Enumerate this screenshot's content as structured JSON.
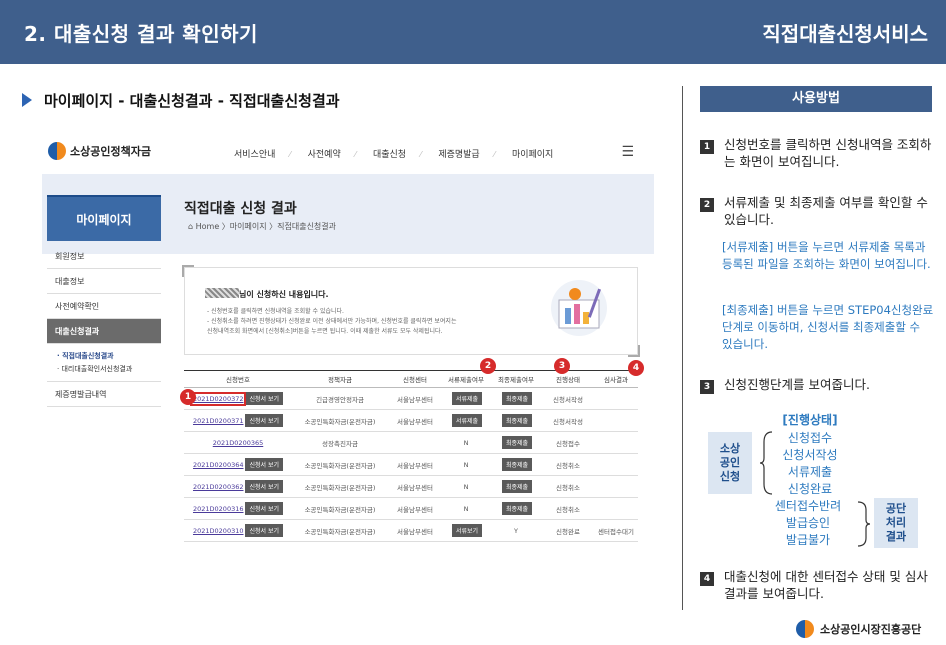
{
  "header": {
    "title": "2. 대출신청 결과 확인하기",
    "service": "직접대출신청서비스"
  },
  "section": {
    "title": "마이페이지 - 대출신청결과 - 직접대출신청결과"
  },
  "site": {
    "logo": "소상공인정책자금",
    "menu": [
      "서비스안내",
      "사전예약",
      "대출신청",
      "제증명발급",
      "마이페이지"
    ],
    "side_title": "마이페이지",
    "page_title": "직접대출 신청 결과",
    "breadcrumb": "⌂ Home 〉마이페이지 〉직접대출신청결과",
    "side_items": [
      "회원정보",
      "대출정보",
      "사전예약확인",
      "대출신청결과"
    ],
    "side_subs": [
      "· 직접대출신청결과",
      "· 대리대출확인서신청결과"
    ],
    "side_last": "제증명발급내역",
    "info_head": "님이 신청하신 내용입니다.",
    "info_lines": [
      "- 신청번호를 클릭하면 신청내역을 조회할 수 있습니다.",
      "- 신청취소를 하려면 진행상태가 신청완료 이전 상태에서만 가능하며, 신청번호를 클릭하면 보여지는",
      "  신청내역조회 화면에서 [신청취소]버튼을 누르면 됩니다. 이때 제출한 서류도 모두 삭제됩니다."
    ],
    "columns": [
      "신청번호",
      "정책자금",
      "신청센터",
      "서류제출여부",
      "최종제출여부",
      "진행상태",
      "심사결과"
    ],
    "view_btn": "신청서 보기",
    "rows": [
      {
        "no": "2021D0200372",
        "view": true,
        "fund": "긴급경영안정자금",
        "center": "서울남부센터",
        "doc": "서류제출",
        "final": "최종제출",
        "status": "신청서작성",
        "result": ""
      },
      {
        "no": "2021D0200371",
        "view": true,
        "fund": "소공인특화자금(운전자금)",
        "center": "서울남부센터",
        "doc": "서류제출",
        "final": "최종제출",
        "status": "신청서작성",
        "result": ""
      },
      {
        "no": "2021D0200365",
        "view": false,
        "fund": "성장촉진자금",
        "center": "",
        "doc": "N",
        "final": "최종제출",
        "status": "신청접수",
        "result": ""
      },
      {
        "no": "2021D0200364",
        "view": true,
        "fund": "소공인특화자금(운전자금)",
        "center": "서울남부센터",
        "doc": "N",
        "final": "최종제출",
        "status": "신청취소",
        "result": ""
      },
      {
        "no": "2021D0200362",
        "view": true,
        "fund": "소공인특화자금(운전자금)",
        "center": "서울남부센터",
        "doc": "N",
        "final": "최종제출",
        "status": "신청취소",
        "result": ""
      },
      {
        "no": "2021D0200316",
        "view": true,
        "fund": "소공인특화자금(운전자금)",
        "center": "서울남부센터",
        "doc": "N",
        "final": "최종제출",
        "status": "신청취소",
        "result": ""
      },
      {
        "no": "2021D0200310",
        "view": true,
        "fund": "소공인특화자금(운전자금)",
        "center": "서울남부센터",
        "doc": "서류보기",
        "final": "Y",
        "status": "신청완료",
        "result": "센터접수대기"
      }
    ]
  },
  "guide": {
    "title": "사용방법",
    "step1": "신청번호를 클릭하면 신청내역을 조회하는 화면이 보여집니다.",
    "step2": "서류제출 및 최종제출 여부를 확인할 수 있습니다.",
    "note1": "[서류제출] 버튼을 누르면 서류제출 목록과 등록된 파일을 조회하는 화면이 보여집니다.",
    "note2": "[최종제출] 버튼을 누르면 STEP04신청완료 단계로 이동하며, 신청서를 최종제출할 수 있습니다.",
    "step3": "신청진행단계를 보여줍니다.",
    "flow_title": "[진행상태]",
    "flow_left": "소상\n공인\n신청",
    "flow_items": [
      "신청접수",
      "신청서작성",
      "서류제출",
      "신청완료"
    ],
    "flow_items2": [
      "센터접수반려",
      "발급승인",
      "발급불가"
    ],
    "flow_right": "공단\n처리\n결과",
    "step4": "대출신청에 대한 센터접수 상태 및 심사결과를 보여줍니다."
  },
  "footer": {
    "org": "소상공인시장진흥공단"
  },
  "colors": {
    "header": "#3f5f8c",
    "accent": "#2d7abf",
    "badge": "#d62b2b"
  }
}
